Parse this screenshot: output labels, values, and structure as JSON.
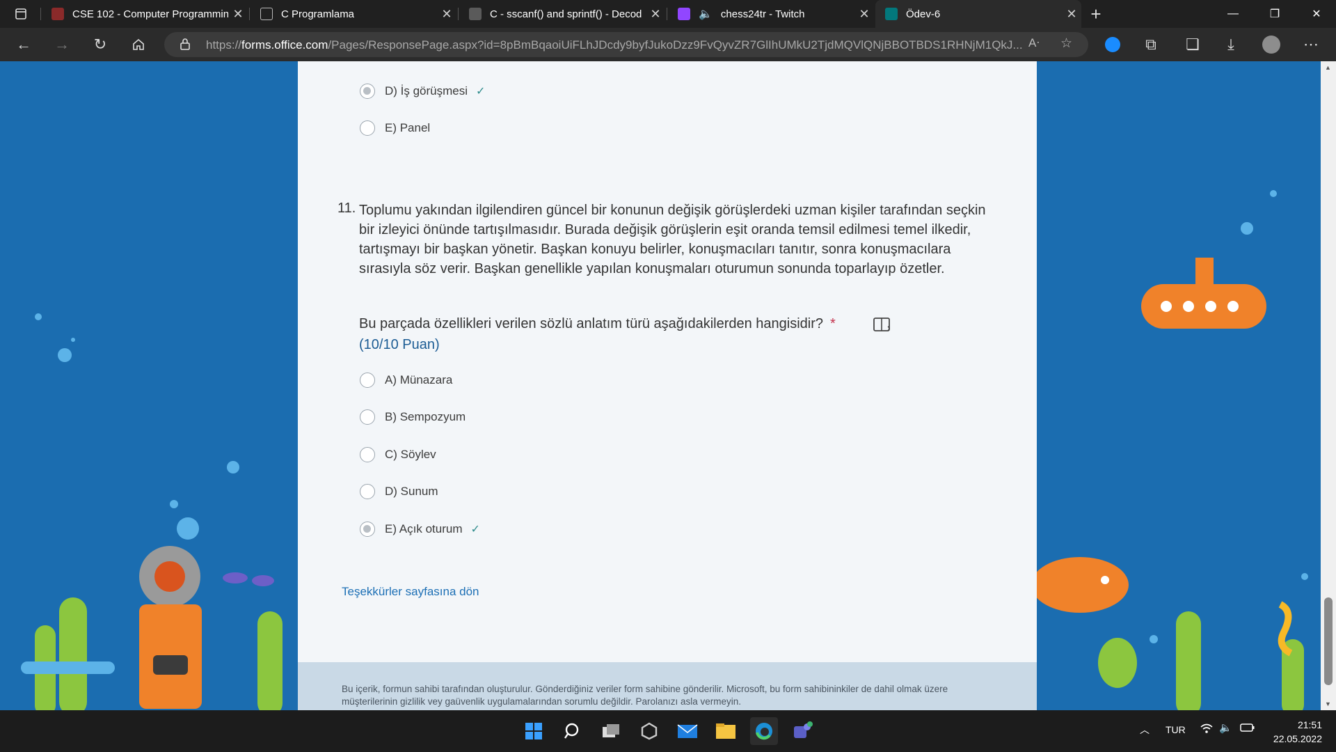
{
  "browser": {
    "tabs": [
      {
        "label": "CSE 102 - Computer Programmin",
        "active": false
      },
      {
        "label": "C Programlama",
        "active": false
      },
      {
        "label": "C - sscanf() and sprintf() - Decod",
        "active": false
      },
      {
        "label": "chess24tr - Twitch",
        "active": false
      },
      {
        "label": "Ödev-6",
        "active": true
      }
    ],
    "url_prefix": "https://",
    "url_host": "forms.office.com",
    "url_rest": "/Pages/ResponsePage.aspx?id=8pBmBqaoiUiFLhJDcdy9byfJukoDzz9FvQyvZR7GlIhUMkU2TjdMQVlQNjBBOTBDS1RHNjM1QkJ..."
  },
  "form": {
    "prev_options": [
      {
        "label": "D) İş görüşmesi",
        "selected": true,
        "correct": true
      },
      {
        "label": "E) Panel",
        "selected": false,
        "correct": false
      }
    ],
    "question": {
      "number": "11.",
      "text": "Toplumu yakından ilgilendiren güncel bir konunun değişik görüşlerdeki uzman kişiler tarafından seçkin bir izleyici önünde tartışılmasıdır. Burada değişik görüşlerin eşit oranda temsil edilmesi temel ilkedir, tartışmayı bir başkan yönetir. Başkan konuyu belirler, konuşmacıları tanıtır, sonra konuşmacılara sırasıyla söz verir. Başkan genellikle yapılan konuşmaları oturumun sonunda toparlayıp özetler.",
      "prompt": "Bu parçada özellikleri verilen sözlü anlatım türü aşağıdakilerden hangisidir?",
      "required_mark": "*",
      "points": "(10/10 Puan)",
      "options": [
        {
          "label": "A) Münazara",
          "selected": false,
          "correct": false
        },
        {
          "label": "B) Sempozyum",
          "selected": false,
          "correct": false
        },
        {
          "label": "C) Söylev",
          "selected": false,
          "correct": false
        },
        {
          "label": "D) Sunum",
          "selected": false,
          "correct": false
        },
        {
          "label": "E) Açık oturum",
          "selected": true,
          "correct": true
        }
      ]
    },
    "back_link": "Teşekkürler sayfasına dön",
    "footer": "Bu içerik, formun sahibi tarafından oluşturulur. Gönderdiğiniz veriler form sahibine gönderilir. Microsoft, bu form sahibininkiler de dahil olmak üzere müşterilerinin gizlilik vey gaüvenlik uygulamalarından sorumlu değildir. Parolanızı asla vermeyin."
  },
  "taskbar": {
    "language": "TUR",
    "time": "21:51",
    "date": "22.05.2022"
  },
  "colors": {
    "page_bg": "#1b6db0",
    "card_bg": "#f3f6f9",
    "link": "#1c6fb5",
    "check": "#2f8c8c",
    "required": "#c4314b"
  }
}
